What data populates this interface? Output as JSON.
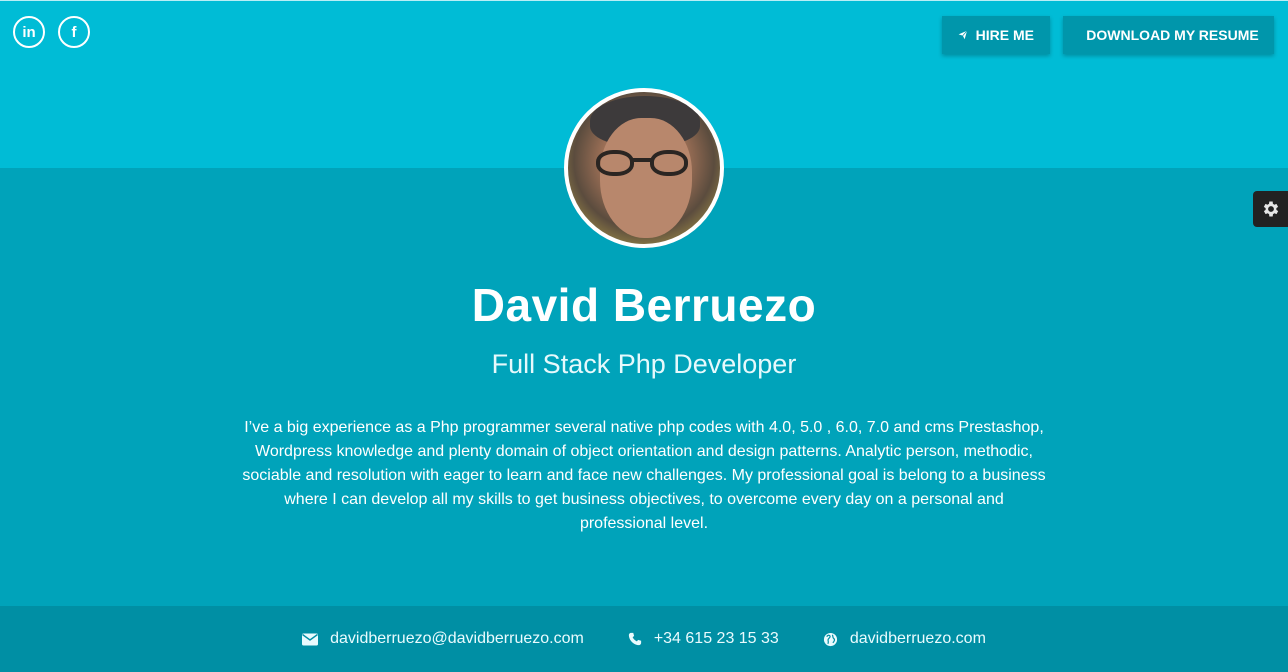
{
  "social": {
    "linkedin_label": "in",
    "facebook_label": "f"
  },
  "header": {
    "hire_label": "HIRE ME",
    "resume_label": "DOWNLOAD MY RESUME"
  },
  "profile": {
    "name": "David Berruezo",
    "role": "Full Stack Php Developer",
    "bio": "I’ve a big experience as a Php programmer several native php codes with 4.0, 5.0 , 6.0, 7.0 and cms Prestashop, Wordpress knowledge and plenty domain of object orientation and design patterns. Analytic person, methodic, sociable and resolution with eager to learn and face new challenges. My professional goal is belong to a business where I can develop all my skills to get business objectives, to overcome every day on a personal and professional level."
  },
  "contact": {
    "email": "davidberruezo@davidberruezo.com",
    "phone": "+34 615 23 15 33",
    "website": "davidberruezo.com"
  },
  "colors": {
    "header_bg": "#00bcd6",
    "main_bg": "#00a3ba",
    "footer_bg": "#008fa4",
    "button_bg": "#0096ab",
    "settings_bg": "#222222"
  },
  "icons": [
    "linkedin-icon",
    "facebook-icon",
    "paper-plane-icon",
    "download-icon",
    "gear-icon",
    "envelope-icon",
    "phone-icon",
    "globe-icon"
  ]
}
